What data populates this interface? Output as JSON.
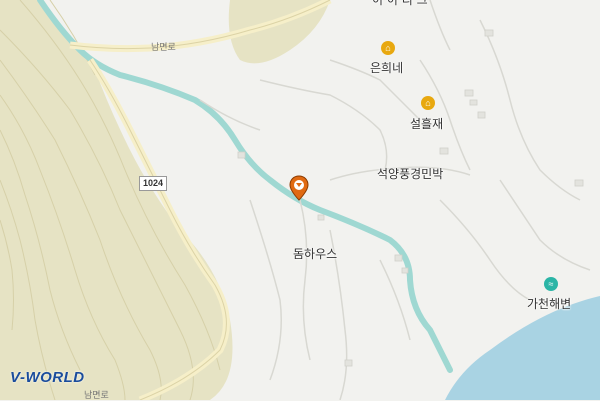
{
  "map": {
    "road_name_top": "남면로",
    "road_name_bottom": "남면로",
    "route_shield": "1024",
    "places": [
      {
        "name": "은희네",
        "icon": "lodging-icon"
      },
      {
        "name": "설흘재",
        "icon": "lodging-icon"
      },
      {
        "name": "석양풍경민박",
        "icon": "none"
      },
      {
        "name": "돔하우스",
        "icon": "none"
      },
      {
        "name": "가천해변",
        "icon": "beach-icon"
      }
    ],
    "top_cut_label": "이 이 리 그",
    "logo": "V-WORLD"
  },
  "colors": {
    "background": "#f2f2ef",
    "terrain": "#e6e3c4",
    "contour": "#d6d0a8",
    "river": "#9fd8d2",
    "sea": "#a9d3e3",
    "road": "#f6efc9",
    "pin": "#e06a12"
  }
}
